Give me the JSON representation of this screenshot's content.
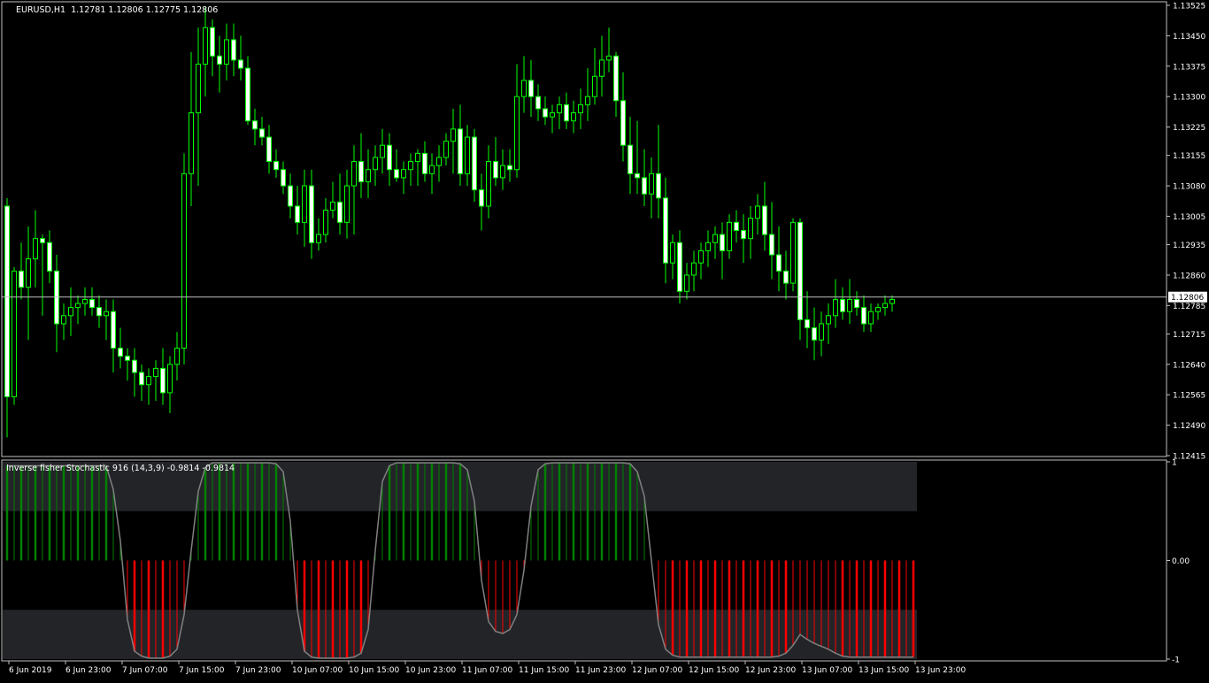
{
  "colors": {
    "background": "#000000",
    "frame": "#c0c0c0",
    "candle": "#00ff00",
    "candle_bull_body": "#000000",
    "candle_bear_body": "#ffffff",
    "bid_line": "#c0c0c0",
    "hist_pos": "#008000",
    "hist_neg": "#ff0000",
    "band": "#222428",
    "signal_line": "#808080",
    "text": "#ffffff"
  },
  "chart_data": [
    {
      "type": "candlestick",
      "title": "EURUSD,H1  1.12781 1.12806 1.12775 1.12806",
      "ylim": [
        1.12415,
        1.13525
      ],
      "y_ticks": [
        "1.13525",
        "1.13450",
        "1.13375",
        "1.13300",
        "1.13225",
        "1.13155",
        "1.13080",
        "1.13005",
        "1.12935",
        "1.12860",
        "1.12785",
        "1.12715",
        "1.12640",
        "1.12565",
        "1.12490",
        "1.12415"
      ],
      "bid_price": 1.12806,
      "bid_label": "1.12806",
      "grid": false,
      "ohlc": [
        [
          1.1303,
          1.1305,
          1.1246,
          1.1256
        ],
        [
          1.1256,
          1.1288,
          1.1254,
          1.1287
        ],
        [
          1.1287,
          1.1294,
          1.128,
          1.1283
        ],
        [
          1.1283,
          1.1298,
          1.127,
          1.129
        ],
        [
          1.129,
          1.1302,
          1.1283,
          1.1295
        ],
        [
          1.1295,
          1.1296,
          1.1276,
          1.1294
        ],
        [
          1.1294,
          1.1297,
          1.1284,
          1.1287
        ],
        [
          1.1287,
          1.1291,
          1.1267,
          1.1274
        ],
        [
          1.1274,
          1.1279,
          1.127,
          1.1276
        ],
        [
          1.1276,
          1.1283,
          1.1271,
          1.1278
        ],
        [
          1.1278,
          1.1281,
          1.1274,
          1.1279
        ],
        [
          1.1279,
          1.1283,
          1.1276,
          1.128
        ],
        [
          1.128,
          1.1283,
          1.1276,
          1.1278
        ],
        [
          1.1278,
          1.1281,
          1.1273,
          1.1276
        ],
        [
          1.1276,
          1.128,
          1.127,
          1.1277
        ],
        [
          1.1277,
          1.128,
          1.1262,
          1.1268
        ],
        [
          1.1268,
          1.1273,
          1.1263,
          1.1266
        ],
        [
          1.1266,
          1.1268,
          1.126,
          1.1265
        ],
        [
          1.1265,
          1.1268,
          1.1256,
          1.1262
        ],
        [
          1.1262,
          1.1264,
          1.1255,
          1.1259
        ],
        [
          1.1259,
          1.1263,
          1.1254,
          1.1261
        ],
        [
          1.1261,
          1.1265,
          1.1255,
          1.1263
        ],
        [
          1.1263,
          1.1268,
          1.1254,
          1.1257
        ],
        [
          1.1257,
          1.1266,
          1.1252,
          1.1264
        ],
        [
          1.1264,
          1.1272,
          1.126,
          1.1268
        ],
        [
          1.1268,
          1.1316,
          1.1264,
          1.1311
        ],
        [
          1.1311,
          1.1341,
          1.1303,
          1.1326
        ],
        [
          1.1326,
          1.1347,
          1.1308,
          1.1338
        ],
        [
          1.1338,
          1.1352,
          1.133,
          1.1347
        ],
        [
          1.1347,
          1.1349,
          1.1335,
          1.134
        ],
        [
          1.134,
          1.1345,
          1.1331,
          1.1338
        ],
        [
          1.1338,
          1.1348,
          1.1334,
          1.1344
        ],
        [
          1.1344,
          1.1348,
          1.1335,
          1.1339
        ],
        [
          1.1339,
          1.1345,
          1.1334,
          1.1337
        ],
        [
          1.1337,
          1.134,
          1.1323,
          1.1324
        ],
        [
          1.1324,
          1.1327,
          1.1318,
          1.1322
        ],
        [
          1.1322,
          1.1325,
          1.1318,
          1.132
        ],
        [
          1.132,
          1.1323,
          1.1311,
          1.1314
        ],
        [
          1.1314,
          1.1317,
          1.131,
          1.1312
        ],
        [
          1.1312,
          1.1314,
          1.1306,
          1.1308
        ],
        [
          1.1308,
          1.1311,
          1.13,
          1.1303
        ],
        [
          1.1303,
          1.1308,
          1.1296,
          1.1299
        ],
        [
          1.1299,
          1.1312,
          1.1293,
          1.1308
        ],
        [
          1.1308,
          1.1312,
          1.129,
          1.1294
        ],
        [
          1.1294,
          1.13,
          1.1292,
          1.1296
        ],
        [
          1.1296,
          1.1305,
          1.1294,
          1.1302
        ],
        [
          1.1302,
          1.1309,
          1.13,
          1.1304
        ],
        [
          1.1304,
          1.1311,
          1.1296,
          1.1299
        ],
        [
          1.1299,
          1.1312,
          1.1295,
          1.1308
        ],
        [
          1.1308,
          1.1318,
          1.1296,
          1.1314
        ],
        [
          1.1314,
          1.1321,
          1.1305,
          1.1309
        ],
        [
          1.1309,
          1.1317,
          1.1305,
          1.1312
        ],
        [
          1.1312,
          1.1318,
          1.1308,
          1.1315
        ],
        [
          1.1315,
          1.1322,
          1.1311,
          1.1318
        ],
        [
          1.1318,
          1.1321,
          1.1308,
          1.1312
        ],
        [
          1.1312,
          1.1317,
          1.1309,
          1.131
        ],
        [
          1.131,
          1.1314,
          1.1306,
          1.1312
        ],
        [
          1.1312,
          1.1316,
          1.1308,
          1.1314
        ],
        [
          1.1314,
          1.1317,
          1.1308,
          1.1316
        ],
        [
          1.1316,
          1.1319,
          1.1309,
          1.1311
        ],
        [
          1.1311,
          1.1316,
          1.1306,
          1.1313
        ],
        [
          1.1313,
          1.1318,
          1.1309,
          1.1315
        ],
        [
          1.1315,
          1.1321,
          1.1313,
          1.1319
        ],
        [
          1.1319,
          1.1327,
          1.1311,
          1.1322
        ],
        [
          1.1322,
          1.1328,
          1.1308,
          1.1311
        ],
        [
          1.1311,
          1.1323,
          1.1308,
          1.132
        ],
        [
          1.132,
          1.1322,
          1.1304,
          1.1307
        ],
        [
          1.1307,
          1.1311,
          1.1297,
          1.1303
        ],
        [
          1.1303,
          1.1318,
          1.13,
          1.1314
        ],
        [
          1.1314,
          1.132,
          1.1308,
          1.131
        ],
        [
          1.131,
          1.1317,
          1.1307,
          1.1313
        ],
        [
          1.1313,
          1.1317,
          1.1309,
          1.1312
        ],
        [
          1.1312,
          1.1338,
          1.131,
          1.133
        ],
        [
          1.133,
          1.134,
          1.1326,
          1.1334
        ],
        [
          1.1334,
          1.1339,
          1.1325,
          1.133
        ],
        [
          1.133,
          1.1333,
          1.1324,
          1.1327
        ],
        [
          1.1327,
          1.133,
          1.1323,
          1.1325
        ],
        [
          1.1325,
          1.1328,
          1.1321,
          1.1326
        ],
        [
          1.1326,
          1.133,
          1.1322,
          1.1328
        ],
        [
          1.1328,
          1.1331,
          1.1322,
          1.1324
        ],
        [
          1.1324,
          1.1329,
          1.1321,
          1.1326
        ],
        [
          1.1326,
          1.1332,
          1.1322,
          1.1328
        ],
        [
          1.1328,
          1.1337,
          1.1324,
          1.133
        ],
        [
          1.133,
          1.1342,
          1.1328,
          1.1335
        ],
        [
          1.1335,
          1.1345,
          1.133,
          1.1339
        ],
        [
          1.1339,
          1.1347,
          1.1336,
          1.134
        ],
        [
          1.134,
          1.1341,
          1.1325,
          1.1329
        ],
        [
          1.1329,
          1.1336,
          1.1314,
          1.1318
        ],
        [
          1.1318,
          1.1325,
          1.1306,
          1.1311
        ],
        [
          1.1311,
          1.1324,
          1.1306,
          1.131
        ],
        [
          1.131,
          1.1317,
          1.1303,
          1.1306
        ],
        [
          1.1306,
          1.1315,
          1.13,
          1.1311
        ],
        [
          1.1311,
          1.1323,
          1.13,
          1.1305
        ],
        [
          1.1305,
          1.131,
          1.1284,
          1.1289
        ],
        [
          1.1289,
          1.1296,
          1.1285,
          1.1294
        ],
        [
          1.1294,
          1.1297,
          1.1279,
          1.1282
        ],
        [
          1.1282,
          1.1289,
          1.128,
          1.1286
        ],
        [
          1.1286,
          1.1292,
          1.1282,
          1.1289
        ],
        [
          1.1289,
          1.1294,
          1.1285,
          1.1292
        ],
        [
          1.1292,
          1.1297,
          1.1288,
          1.1294
        ],
        [
          1.1294,
          1.1298,
          1.129,
          1.1296
        ],
        [
          1.1296,
          1.1299,
          1.1285,
          1.1292
        ],
        [
          1.1292,
          1.1301,
          1.129,
          1.1299
        ],
        [
          1.1299,
          1.1302,
          1.1294,
          1.1297
        ],
        [
          1.1297,
          1.1301,
          1.1289,
          1.1295
        ],
        [
          1.1295,
          1.1303,
          1.129,
          1.13
        ],
        [
          1.13,
          1.1306,
          1.1296,
          1.1303
        ],
        [
          1.1303,
          1.1309,
          1.1292,
          1.1296
        ],
        [
          1.1296,
          1.1304,
          1.1285,
          1.1291
        ],
        [
          1.1291,
          1.1298,
          1.1282,
          1.1287
        ],
        [
          1.1287,
          1.1292,
          1.128,
          1.1284
        ],
        [
          1.1284,
          1.13,
          1.1282,
          1.1299
        ],
        [
          1.1299,
          1.13,
          1.127,
          1.1275
        ],
        [
          1.1275,
          1.1282,
          1.1268,
          1.1273
        ],
        [
          1.1273,
          1.1278,
          1.1265,
          1.127
        ],
        [
          1.127,
          1.1277,
          1.1266,
          1.1274
        ],
        [
          1.1274,
          1.1279,
          1.1269,
          1.1276
        ],
        [
          1.1276,
          1.1285,
          1.1273,
          1.128
        ],
        [
          1.128,
          1.1283,
          1.1275,
          1.1277
        ],
        [
          1.1277,
          1.1285,
          1.1274,
          1.128
        ],
        [
          1.128,
          1.1282,
          1.1276,
          1.1278
        ],
        [
          1.1278,
          1.1281,
          1.1272,
          1.1274
        ],
        [
          1.1274,
          1.1279,
          1.1272,
          1.1277
        ],
        [
          1.1277,
          1.1279,
          1.1275,
          1.1278
        ],
        [
          1.1278,
          1.1281,
          1.1276,
          1.1279
        ],
        [
          1.1279,
          1.1281,
          1.1277,
          1.128
        ]
      ],
      "x_labels": [
        {
          "bar": 1,
          "text": "6 Jun 2019"
        },
        {
          "bar": 9,
          "text": "6 Jun 23:00"
        },
        {
          "bar": 17,
          "text": "7 Jun 07:00"
        },
        {
          "bar": 25,
          "text": "7 Jun 15:00"
        },
        {
          "bar": 33,
          "text": "7 Jun 23:00"
        },
        {
          "bar": 41,
          "text": "10 Jun 07:00"
        },
        {
          "bar": 49,
          "text": "10 Jun 15:00"
        },
        {
          "bar": 57,
          "text": "10 Jun 23:00"
        },
        {
          "bar": 65,
          "text": "11 Jun 07:00"
        },
        {
          "bar": 73,
          "text": "11 Jun 15:00"
        },
        {
          "bar": 81,
          "text": "11 Jun 23:00"
        },
        {
          "bar": 89,
          "text": "12 Jun 07:00"
        },
        {
          "bar": 97,
          "text": "12 Jun 15:00"
        },
        {
          "bar": 105,
          "text": "12 Jun 23:00"
        },
        {
          "bar": 113,
          "text": "13 Jun 07:00"
        },
        {
          "bar": 121,
          "text": "13 Jun 15:00"
        },
        {
          "bar": 129,
          "text": "13 Jun 23:00"
        }
      ]
    },
    {
      "type": "bar",
      "title": "Inverse fisher Stochastic 916 (14,3,9) -0.9814 -0.9814",
      "ylim": [
        -1,
        1
      ],
      "y_ticks": [
        "1",
        "0.00",
        "-1"
      ],
      "bands": [
        [
          0.5,
          1
        ],
        [
          -1,
          -0.5
        ]
      ],
      "grid": false,
      "series": [
        {
          "kind": "histogram",
          "values": [
            0.96,
            0.96,
            0.96,
            0.96,
            0.96,
            0.96,
            0.96,
            0.96,
            0.96,
            0.96,
            0.96,
            0.96,
            0.96,
            0.96,
            0.96,
            0.72,
            0.2,
            -0.6,
            -0.92,
            -0.97,
            -0.99,
            -0.99,
            -0.99,
            -0.97,
            -0.9,
            -0.55,
            0.1,
            0.7,
            0.94,
            0.99,
            0.99,
            0.99,
            0.99,
            0.99,
            0.99,
            0.99,
            0.99,
            0.99,
            0.98,
            0.9,
            0.4,
            -0.5,
            -0.92,
            -0.98,
            -0.99,
            -0.99,
            -0.99,
            -0.99,
            -0.99,
            -0.98,
            -0.94,
            -0.7,
            0.1,
            0.8,
            0.96,
            0.99,
            0.99,
            0.99,
            0.99,
            0.99,
            0.99,
            0.99,
            0.99,
            0.99,
            0.98,
            0.92,
            0.6,
            -0.2,
            -0.62,
            -0.72,
            -0.74,
            -0.7,
            -0.55,
            -0.1,
            0.55,
            0.92,
            0.98,
            0.99,
            0.99,
            0.99,
            0.99,
            0.99,
            0.99,
            0.99,
            0.99,
            0.99,
            0.99,
            0.99,
            0.98,
            0.9,
            0.65,
            0.0,
            -0.65,
            -0.9,
            -0.96,
            -0.98,
            -0.98,
            -0.98,
            -0.98,
            -0.98,
            -0.98,
            -0.98,
            -0.98,
            -0.98,
            -0.98,
            -0.98,
            -0.98,
            -0.98,
            -0.98,
            -0.97,
            -0.94,
            -0.86,
            -0.75,
            -0.8,
            -0.84,
            -0.87,
            -0.9,
            -0.94,
            -0.97,
            -0.98,
            -0.98,
            -0.98,
            -0.98,
            -0.98,
            -0.98,
            -0.98,
            -0.98,
            -0.98,
            -0.98
          ]
        },
        {
          "kind": "line",
          "values": "same"
        }
      ]
    }
  ]
}
